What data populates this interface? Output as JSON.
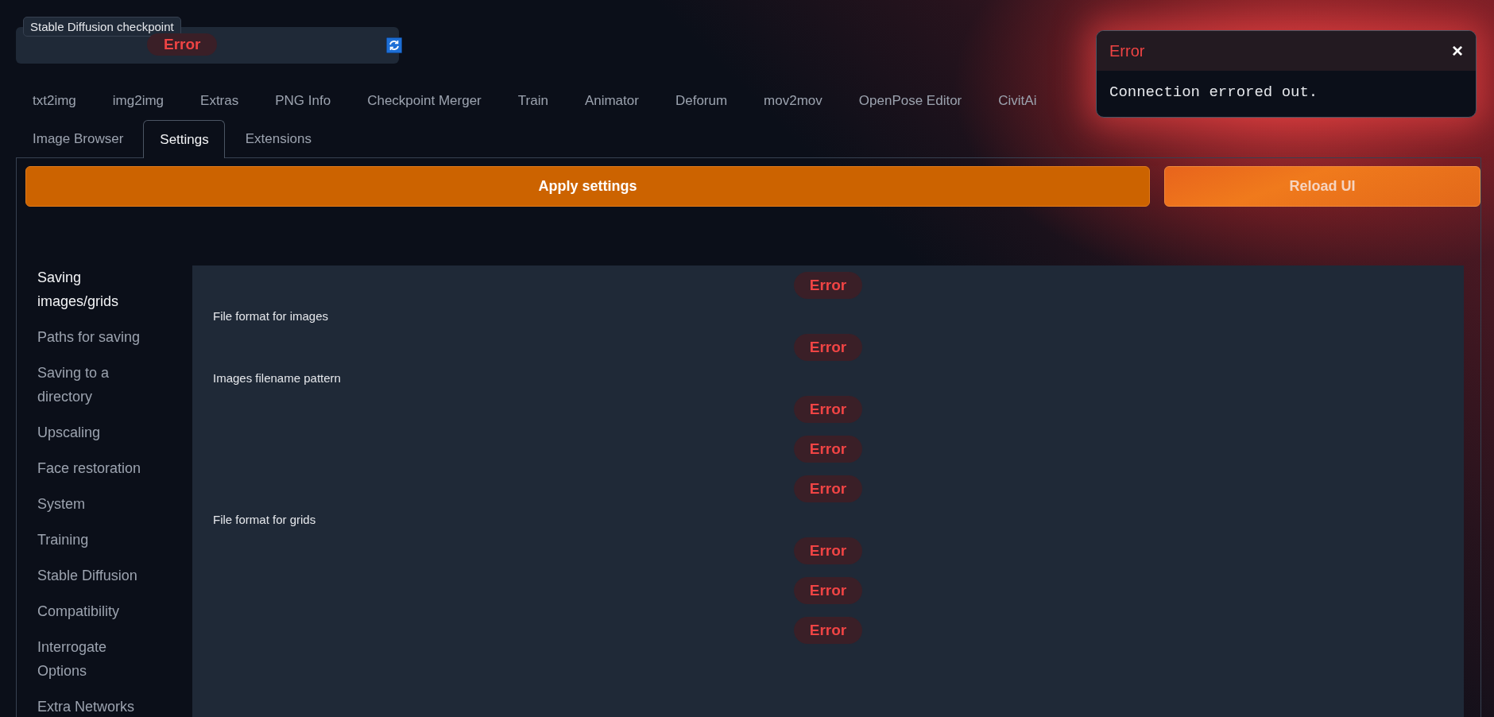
{
  "checkpoint": {
    "label": "Stable Diffusion checkpoint",
    "value": "Error"
  },
  "tabs": [
    {
      "label": "txt2img",
      "selected": false
    },
    {
      "label": "img2img",
      "selected": false
    },
    {
      "label": "Extras",
      "selected": false
    },
    {
      "label": "PNG Info",
      "selected": false
    },
    {
      "label": "Checkpoint Merger",
      "selected": false
    },
    {
      "label": "Train",
      "selected": false
    },
    {
      "label": "Animator",
      "selected": false
    },
    {
      "label": "Deforum",
      "selected": false
    },
    {
      "label": "mov2mov",
      "selected": false
    },
    {
      "label": "OpenPose Editor",
      "selected": false
    },
    {
      "label": "CivitAi",
      "selected": false
    },
    {
      "label": "Image Browser",
      "selected": false
    },
    {
      "label": "Settings",
      "selected": true
    },
    {
      "label": "Extensions",
      "selected": false
    }
  ],
  "buttons": [
    {
      "label": "Apply settings",
      "kind": "primary"
    },
    {
      "label": "Reload UI",
      "kind": "secondary"
    }
  ],
  "sidebar": {
    "items": [
      {
        "label": "Saving images/grids",
        "selected": true
      },
      {
        "label": "Paths for saving",
        "selected": false
      },
      {
        "label": "Saving to a directory",
        "selected": false
      },
      {
        "label": "Upscaling",
        "selected": false
      },
      {
        "label": "Face restoration",
        "selected": false
      },
      {
        "label": "System",
        "selected": false
      },
      {
        "label": "Training",
        "selected": false
      },
      {
        "label": "Stable Diffusion",
        "selected": false
      },
      {
        "label": "Compatibility",
        "selected": false
      },
      {
        "label": "Interrogate Options",
        "selected": false
      },
      {
        "label": "Extra Networks",
        "selected": false
      }
    ]
  },
  "settings": [
    {
      "kind": "error",
      "text": "Error"
    },
    {
      "kind": "label",
      "text": "File format for images"
    },
    {
      "kind": "error",
      "text": "Error"
    },
    {
      "kind": "label",
      "text": "Images filename pattern"
    },
    {
      "kind": "error",
      "text": "Error"
    },
    {
      "kind": "error",
      "text": "Error"
    },
    {
      "kind": "error",
      "text": "Error"
    },
    {
      "kind": "label",
      "text": "File format for grids"
    },
    {
      "kind": "error",
      "text": "Error"
    },
    {
      "kind": "error",
      "text": "Error"
    },
    {
      "kind": "error",
      "text": "Error"
    }
  ],
  "toast": {
    "title": "Error",
    "close": "×",
    "message": "Connection errored out."
  }
}
